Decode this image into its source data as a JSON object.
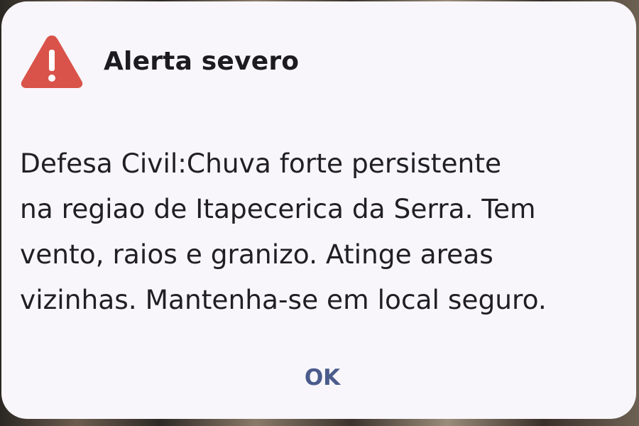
{
  "dialog": {
    "title": "Alerta severo",
    "icon": "warning-triangle-icon",
    "message": "Defesa Civil:Chuva forte persistente\nna regiao de Itapecerica da Serra. Tem\nvento, raios e granizo. Atinge areas\nvizinhas. Mantenha-se em local seguro.",
    "ok_label": "OK"
  },
  "colors": {
    "dialog_background": "#f8f6fa",
    "warning_icon": "#d9534a",
    "ok_text": "#4a5b8c"
  }
}
